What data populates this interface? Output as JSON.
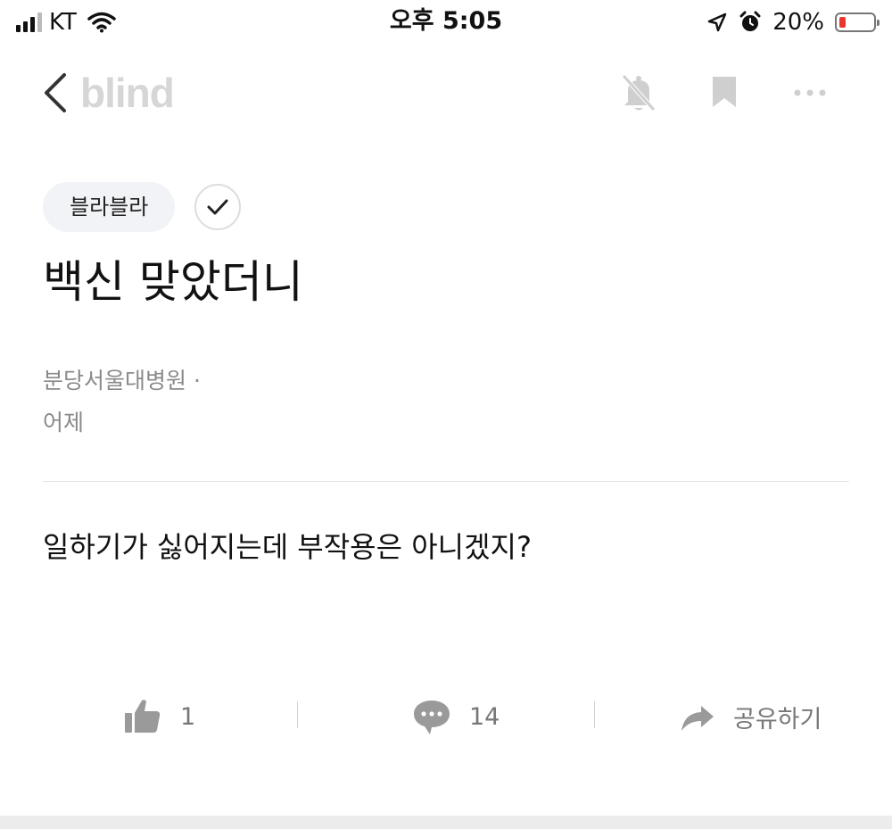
{
  "status_bar": {
    "carrier": "KT",
    "time": "오후 5:05",
    "battery": "20%",
    "battery_level": 0.2
  },
  "nav": {
    "logo": "blind",
    "icons": [
      "chevron-left-icon",
      "bell-off-icon",
      "bookmark-icon",
      "more-icon"
    ]
  },
  "post": {
    "topic": "블라블라",
    "title": "백신 맞았더니",
    "company": "분당서울대병원 ·",
    "time": "어제",
    "body": "일하기가 싫어지는데 부작용은 아니겠지?"
  },
  "actions": {
    "like_count": "1",
    "comment_count": "14",
    "share_label": "공유하기"
  },
  "colors": {
    "logo": "#d6d6d6",
    "chip_bg": "#f1f3f6",
    "meta": "#8a8a8a",
    "icon": "#9a9a9a",
    "battery_low": "#e8372d"
  }
}
